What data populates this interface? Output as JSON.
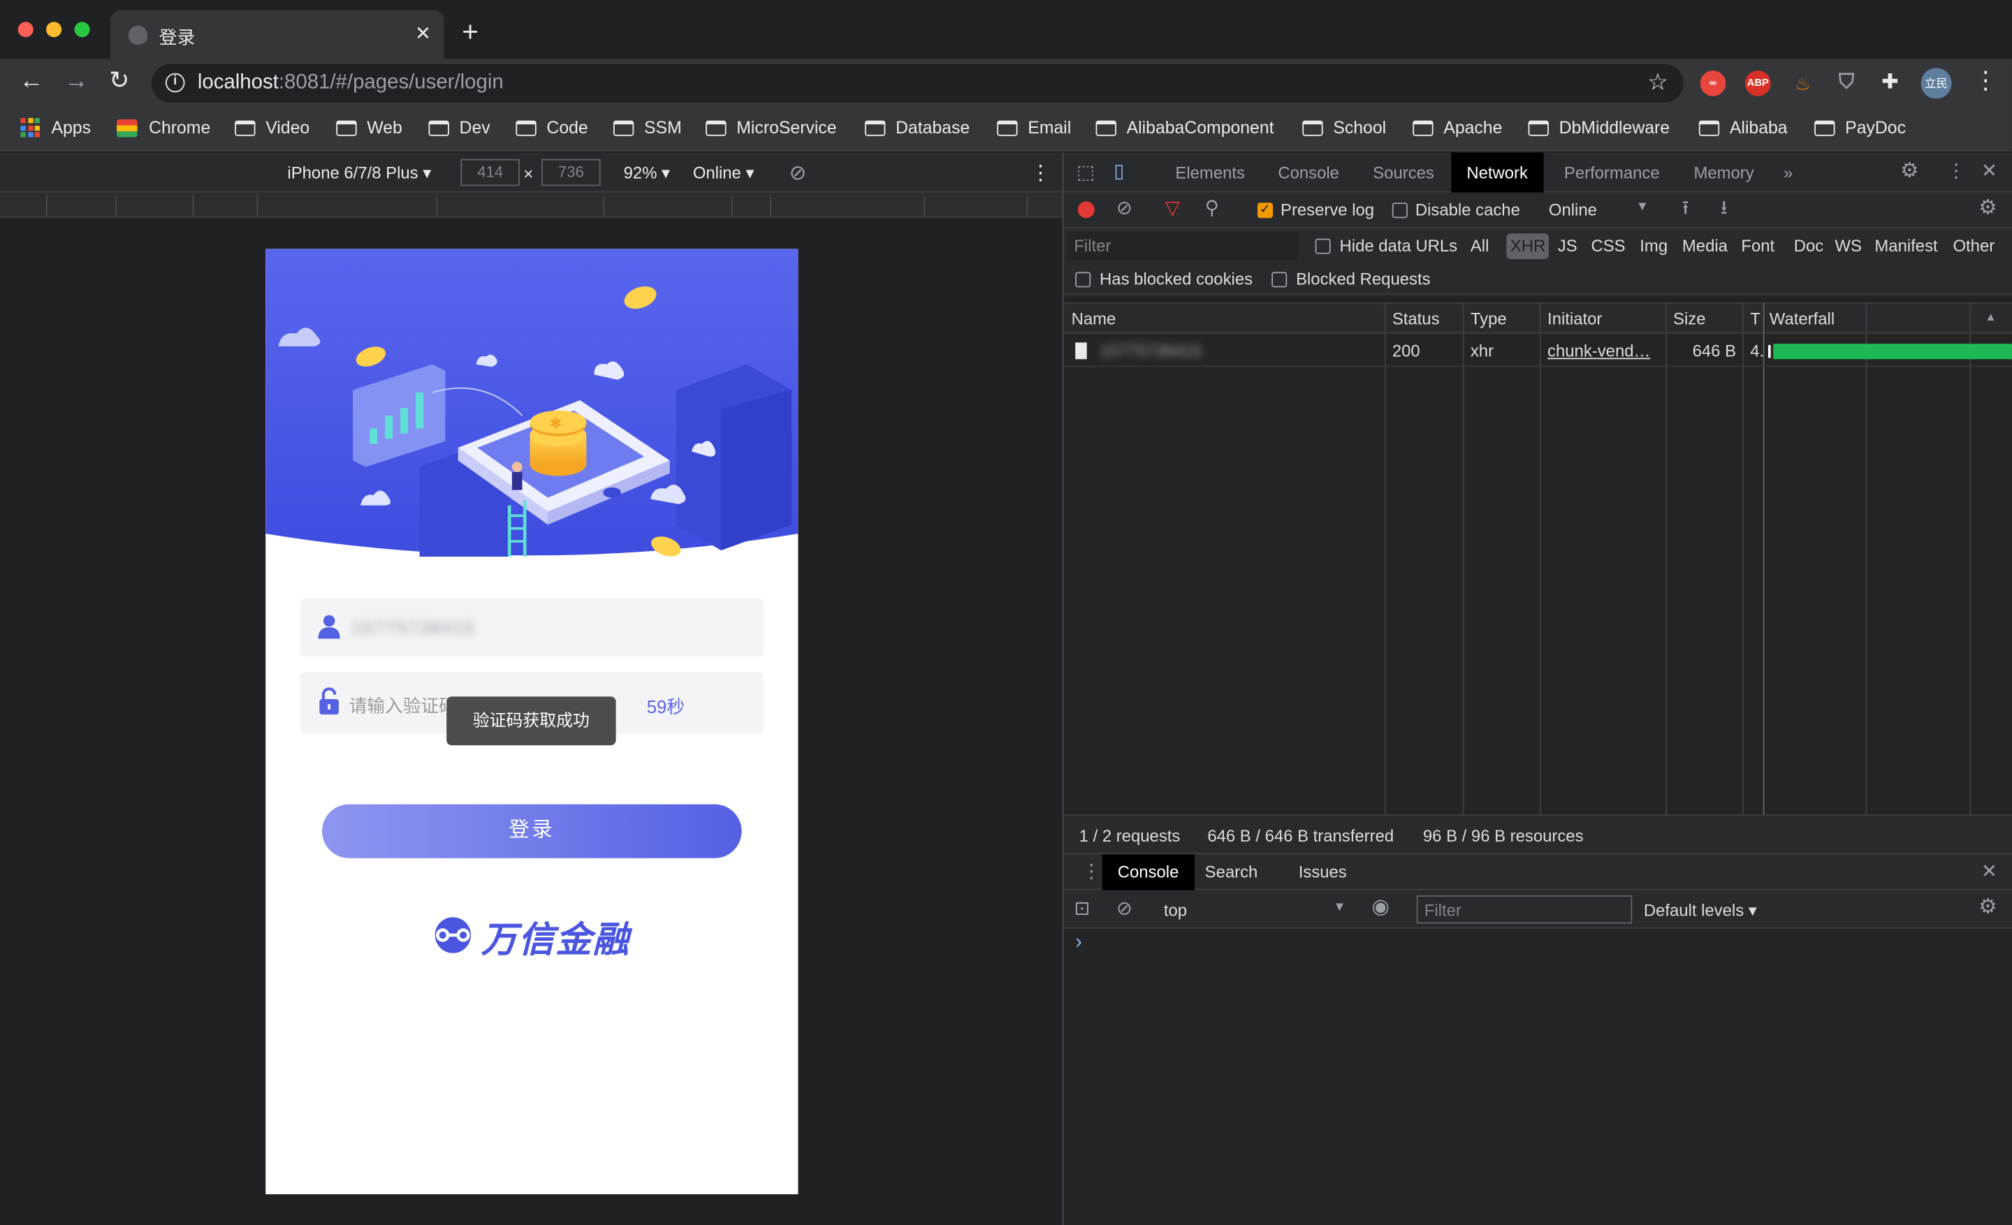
{
  "browser": {
    "tab_title": "登录",
    "tab_close": "✕",
    "new_tab": "+",
    "url_host": "localhost",
    "url_rest": ":8081/#/pages/user/login",
    "profile_initials": "立民",
    "ext_abp": "ABP"
  },
  "bookmarks": [
    "Apps",
    "Chrome",
    "Video",
    "Web",
    "Dev",
    "Code",
    "SSM",
    "MicroService",
    "Database",
    "Email",
    "AlibabaComponent",
    "School",
    "Apache",
    "DbMiddleware",
    "Alibaba",
    "PayDoc"
  ],
  "device_toolbar": {
    "device": "iPhone 6/7/8 Plus ▾",
    "width": "414",
    "height": "736",
    "times": "×",
    "zoom": "92% ▾",
    "throttle": "Online ▾"
  },
  "login_page": {
    "phone_value": "15775738415",
    "code_placeholder": "请输入验证码",
    "countdown": "59秒",
    "toast": "验证码获取成功",
    "login_button": "登录",
    "brand": "万信金融"
  },
  "devtools": {
    "tabs": [
      "Elements",
      "Console",
      "Sources",
      "Network",
      "Performance",
      "Memory"
    ],
    "active_tab": "Network",
    "more_tabs": "»",
    "preserve_log": "Preserve log",
    "disable_cache": "Disable cache",
    "throttle": "Online",
    "filter_placeholder": "Filter",
    "hide_data_urls": "Hide data URLs",
    "type_filters": [
      "All",
      "XHR",
      "JS",
      "CSS",
      "Img",
      "Media",
      "Font",
      "Doc",
      "WS",
      "Manifest",
      "Other"
    ],
    "has_blocked_cookies": "Has blocked cookies",
    "blocked_requests": "Blocked Requests",
    "columns": [
      "Name",
      "Status",
      "Type",
      "Initiator",
      "Size",
      "T",
      "Waterfall"
    ],
    "rows": [
      {
        "name": "15775738415",
        "status": "200",
        "type": "xhr",
        "initiator": "chunk-vend…",
        "size": "646 B",
        "time": "4."
      }
    ],
    "summary": {
      "requests": "1 / 2 requests",
      "transferred": "646 B / 646 B transferred",
      "resources": "96 B / 96 B resources"
    },
    "drawer_tabs": [
      "Console",
      "Search",
      "Issues"
    ],
    "context": "top",
    "console_filter": "Filter",
    "levels": "Default levels ▾",
    "prompt": "›"
  },
  "colors": {
    "accent": "#5b66e6",
    "record": "#e53935",
    "waterfall": "#1db954",
    "preserve_check": "#f29900"
  }
}
